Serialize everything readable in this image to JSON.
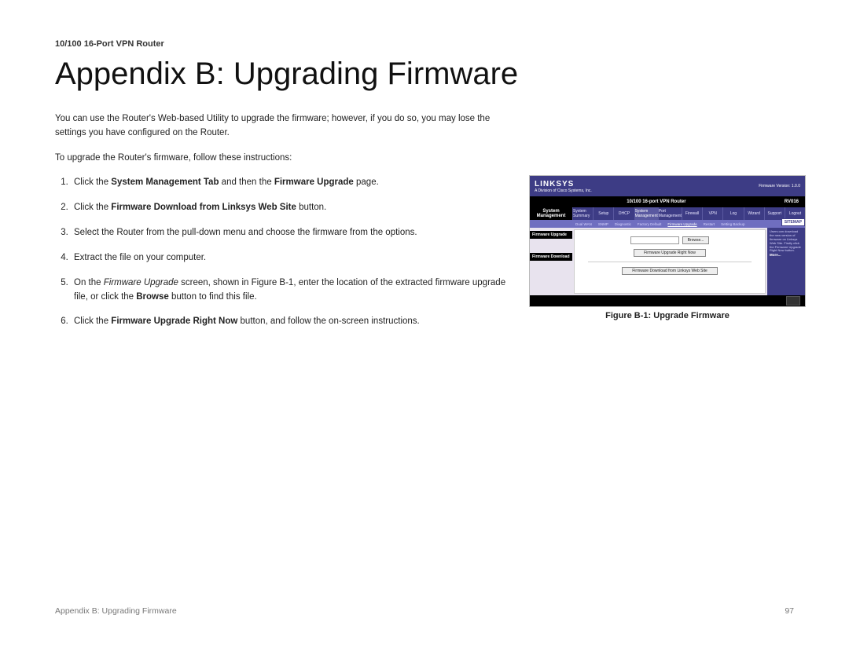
{
  "header": {
    "running": "10/100 16-Port VPN Router"
  },
  "title": "Appendix B: Upgrading Firmware",
  "intro": "You can use the Router's Web-based Utility to upgrade the firmware; however, if you do so, you may lose the settings you have configured on the Router.",
  "lead": "To upgrade the Router's firmware, follow these instructions:",
  "steps": {
    "s1a": "Click the ",
    "s1b": "System Management Tab",
    "s1c": " and then the ",
    "s1d": "Firmware Upgrade",
    "s1e": " page.",
    "s2a": "Click the ",
    "s2b": "Firmware Download from Linksys Web Site",
    "s2c": " button.",
    "s3": "Select the Router from the pull-down menu and choose the firmware from the options.",
    "s4": "Extract the file on your computer.",
    "s5a": "On the ",
    "s5b": "Firmware Upgrade",
    "s5c": " screen, shown in Figure B-1, enter the location of the extracted firmware upgrade file, or click the ",
    "s5d": "Browse",
    "s5e": " button to find this file.",
    "s6a": "Click the ",
    "s6b": "Firmware Upgrade Right Now",
    "s6c": " button, and follow the on-screen instructions."
  },
  "figure": {
    "caption": "Figure B-1: Upgrade Firmware",
    "logo": "LINKSYS",
    "logo_sub": "A Division of Cisco Systems, Inc.",
    "fw_ver": "Firmware Version: 1.0.0",
    "model": "10/100 16-port VPN Router",
    "model_code": "RV016",
    "section": "System Management",
    "tabs": [
      "System Summary",
      "Setup",
      "DHCP",
      "System Management",
      "Port Management",
      "Firewall",
      "VPN",
      "Log",
      "Wizard",
      "Support",
      "Logout"
    ],
    "subtabs": [
      "Dual WAN",
      "SNMP",
      "Diagnostic",
      "Factory Default",
      "Firmware Upgrade",
      "Restart",
      "Setting Backup"
    ],
    "side1": "Firmware Upgrade",
    "side2": "Firmware Download",
    "browse": "Browse...",
    "btn1": "Firmware Upgrade Right Now",
    "btn2": "Firmware Download from Linksys Web Site",
    "sitemap": "SITEMAP",
    "help_label": "More...",
    "help_text": "Users can download the new version of firmware on Linksys Web Site. Firstly click the Firmware Upgrade Right Now button."
  },
  "footer": {
    "left": "Appendix B: Upgrading Firmware",
    "right": "97"
  }
}
